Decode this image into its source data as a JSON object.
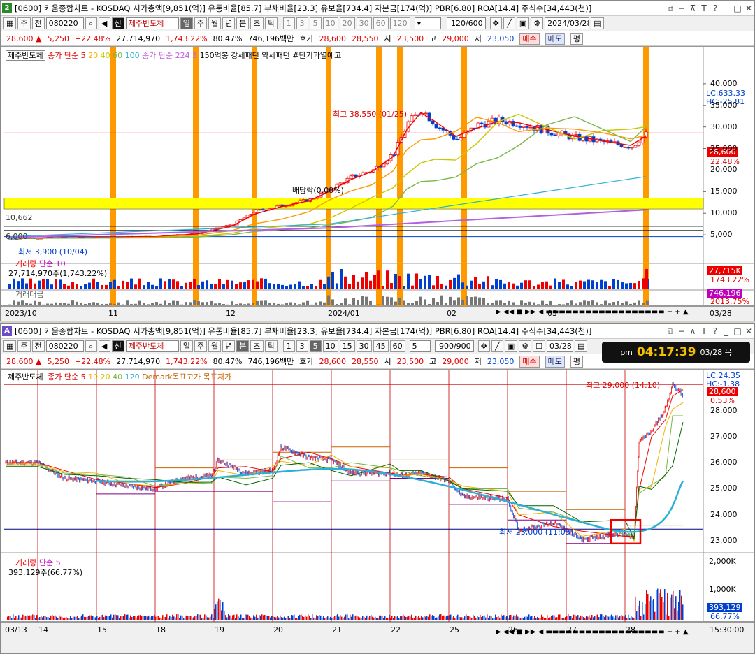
{
  "top": {
    "window_number": "2",
    "title": "[0600] 키움종합차트 - KOSDAQ 시가총액[9,851(억)] 유통비율[85.7] 부채비율[23.3] 유보율[734.4] 자본금[174(억)] PBR[6.80] ROA[14.4] 주식수[34,443(천)]",
    "toolbar": {
      "mode1": "주",
      "mode2": "전",
      "code": "080220",
      "badge": "신",
      "name": "제주반도체",
      "periods": [
        "일",
        "주",
        "월",
        "년",
        "분",
        "초",
        "틱"
      ],
      "selected": "일",
      "nums": [
        "1",
        "3",
        "5",
        "10",
        "20",
        "30",
        "60",
        "120"
      ],
      "count": "120/600",
      "date": "2024/03/28"
    },
    "price": {
      "last": "28,600",
      "change": "5,250",
      "pct": "+22.48%",
      "volume": "27,714,970",
      "vol_pct": "1,743.22%",
      "rate": "80.47%",
      "amount": "746,196백만",
      "ask_label": "호가",
      "ask": "28,600",
      "bid": "28,550",
      "open_label": "시",
      "open": "23,500",
      "high_label": "고",
      "high": "29,000",
      "low_label": "저",
      "low": "23,050",
      "buy": "매수",
      "sell": "매도",
      "avg": "평"
    },
    "legend": {
      "name": "제주반도체",
      "ma": "종가 단순",
      "ma_periods": [
        "5",
        "20",
        "40",
        "60",
        "100"
      ],
      "ma2": "종가 단순",
      "ma2_periods": [
        "224",
        "3"
      ],
      "extra": "150억봉 강세패턴  약세패턴  #단기과열예고"
    },
    "annotations": {
      "high": "최고 38,550 (01/25)",
      "low": "최저 3,900 (10/04)",
      "div": "배당락(0.00%)",
      "band": "10,662",
      "line": "6,000"
    },
    "right": {
      "lc": "LC:633.33",
      "hc": "HC:-25.81",
      "price": "28,600",
      "pct": "22.48%",
      "vol": "27,715K",
      "volpct": "1743.22%",
      "amt": "746,196",
      "amtpct": "2013.75%"
    },
    "y_ticks": [
      "40,000",
      "35,000",
      "30,000",
      "25,000",
      "20,000",
      "15,000",
      "10,000",
      "5,000"
    ],
    "volume": {
      "title": "거래량",
      "ma": "단순 10",
      "value": "27,714,970주(1,743.22%)"
    },
    "amount_title": "거래대금",
    "x_ticks": [
      "2023/10",
      "11",
      "12",
      "2024/01",
      "02",
      "03"
    ],
    "x_right": "03/28"
  },
  "bottom": {
    "window_number": "A",
    "title": "[0600] 키움종합차트 - KOSDAQ 시가총액[9,851(억)] 유통비율[85.7] 부채비율[23.3] 유보율[734.4] 자본금[174(억)] PBR[6.80] ROA[14.4] 주식수[34,443(천)]",
    "toolbar": {
      "mode1": "주",
      "mode2": "전",
      "code": "080220",
      "badge": "신",
      "name": "제주반도체",
      "periods": [
        "일",
        "주",
        "월",
        "년",
        "분",
        "초",
        "틱"
      ],
      "selected": "분",
      "nums": [
        "1",
        "3",
        "5",
        "10",
        "15",
        "30",
        "45",
        "60"
      ],
      "sel_num": "5",
      "unit": "5",
      "count": "900/900",
      "date": "03/28"
    },
    "clock": {
      "ampm": "pm",
      "time": "04:17:39",
      "date": "03/28 목"
    },
    "legend": {
      "name": "제주반도체",
      "ma": "종가 단순",
      "ma_periods": [
        "5",
        "10",
        "20",
        "40",
        "120"
      ],
      "extra": "Demark목표고가  목표저가"
    },
    "annotations": {
      "high": "최고 29,000 (14:10)",
      "low": "최저 23,000 (11:05)"
    },
    "right": {
      "lc": "LC:24.35",
      "hc": "HC:-1.38",
      "price": "28,600",
      "pct": "0.53%",
      "vol": "393,129",
      "volpct": "66.77%"
    },
    "y_ticks": [
      "28,000",
      "27,000",
      "26,000",
      "25,000",
      "24,000",
      "23,000"
    ],
    "vol_ticks": [
      "2,000K",
      "1,000K"
    ],
    "volume": {
      "title": "거래량",
      "ma": "단순 5",
      "value": "393,129주(66.77%)"
    },
    "x_ticks": [
      "03/13",
      "14",
      "15",
      "18",
      "19",
      "20",
      "21",
      "22",
      "25",
      "26",
      "27",
      "28"
    ],
    "x_right": "15:30:00"
  },
  "colors": {
    "red": "#e00000",
    "blue": "#0040d0",
    "orange": "#ff9900",
    "yellow": "#ffff00"
  }
}
